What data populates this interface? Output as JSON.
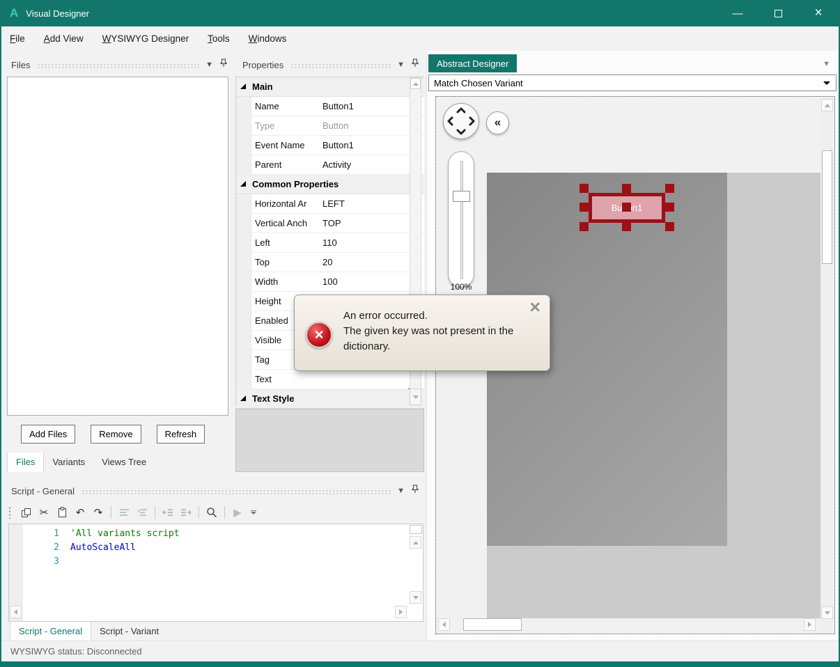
{
  "window": {
    "title": "Visual Designer",
    "logo_letter": "A",
    "controls": {
      "minimize": "—",
      "close": "×"
    }
  },
  "menu": {
    "items": [
      {
        "key": "F",
        "rest": "ile"
      },
      {
        "key": "A",
        "rest": "dd View"
      },
      {
        "key": "W",
        "rest": "YSIWYG Designer"
      },
      {
        "key": "T",
        "rest": "ools"
      },
      {
        "key": "W2",
        "keychar": "W",
        "rest": "indows"
      }
    ]
  },
  "files_panel": {
    "title": "Files",
    "buttons": [
      "Add Files",
      "Remove",
      "Refresh"
    ],
    "tabs": [
      {
        "label": "Files",
        "active": true
      },
      {
        "label": "Variants",
        "active": false
      },
      {
        "label": "Views Tree",
        "active": false
      }
    ]
  },
  "properties_panel": {
    "title": "Properties",
    "sections": [
      {
        "title": "Main",
        "rows": [
          {
            "label": "Name",
            "value": "Button1"
          },
          {
            "label": "Type",
            "value": "Button",
            "muted": true
          },
          {
            "label": "Event Name",
            "value": "Button1"
          },
          {
            "label": "Parent",
            "value": "Activity"
          }
        ]
      },
      {
        "title": "Common Properties",
        "rows": [
          {
            "label": "Horizontal Ar",
            "value": "LEFT",
            "dropdown": true
          },
          {
            "label": "Vertical Anch",
            "value": "TOP",
            "dropdown": true
          },
          {
            "label": "Left",
            "value": "110"
          },
          {
            "label": "Top",
            "value": "20"
          },
          {
            "label": "Width",
            "value": "100"
          },
          {
            "label": "Height",
            "value": ""
          },
          {
            "label": "Enabled",
            "value": ""
          },
          {
            "label": "Visible",
            "value": ""
          },
          {
            "label": "Tag",
            "value": ""
          },
          {
            "label": "Text",
            "value": "",
            "ellipsis": "..."
          }
        ]
      },
      {
        "title": "Text Style",
        "rows": []
      }
    ]
  },
  "script_panel": {
    "title": "Script - General",
    "tabs": [
      {
        "label": "Script - General",
        "active": true
      },
      {
        "label": "Script - Variant",
        "active": false
      }
    ],
    "code": {
      "lines": [
        {
          "num": "1",
          "text": "'All variants script",
          "kind": "comment"
        },
        {
          "num": "2",
          "text": "AutoScaleAll",
          "kind": "ident"
        },
        {
          "num": "3",
          "text": "",
          "kind": ""
        }
      ]
    }
  },
  "designer": {
    "tab_label": "Abstract Designer",
    "variant_combo_value": "Match Chosen Variant",
    "zoom_label": "100%",
    "collapse_glyph": "«",
    "button_label": "Button1"
  },
  "dialog": {
    "close_glyph": "×",
    "error_glyph": "×",
    "lines": [
      "An error occurred.",
      "The given key was not present in the",
      "dictionary."
    ]
  },
  "status_bar": {
    "text": "WYSIWYG status: Disconnected"
  },
  "colors": {
    "accent_teal": "#12776a",
    "logo_teal": "#45c8b8",
    "error_red": "#c1121c",
    "designed_button_fill": "#dfa3ab",
    "designed_button_border": "#9c1016",
    "code_comment_green": "#008000",
    "code_identifier_blue": "#0000cc",
    "line_number_teal": "#2b91af"
  }
}
